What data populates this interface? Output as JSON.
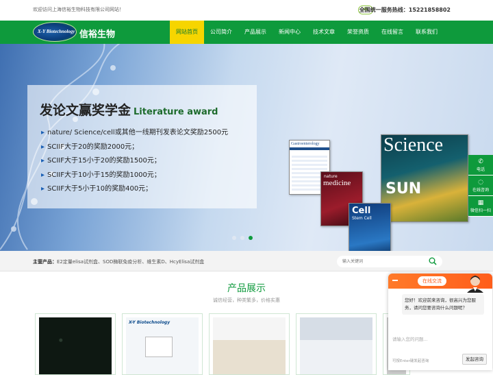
{
  "topbar": {
    "welcome": "欢迎访问上海信裕生物科技有限公司网站！",
    "hotline_label": "全国统一服务热线：",
    "hotline_number": "15221858802"
  },
  "logo": {
    "mark_text": "X-Y Biotechnology",
    "name": "信裕生物"
  },
  "nav": {
    "items": [
      "网站首页",
      "公司简介",
      "产品展示",
      "新闻中心",
      "技术文章",
      "荣誉资质",
      "在线留言",
      "联系我们"
    ],
    "active_index": 0
  },
  "banner": {
    "title": "发论文赢奖学金",
    "title_en": "Literature award",
    "list": [
      "nature/ Science/cell或其他一线期刊发表论文奖励2500元",
      "SCIIF大于20的奖励2000元；",
      "SCIIF大于15小于20的奖励1500元；",
      "SCIIF大于10小于15的奖励1000元；",
      "SCIIF大于5小于10的奖励400元；"
    ],
    "journals": {
      "gastro": "Gastroenterology",
      "medicine_top": "nature",
      "medicine": "medicine",
      "cell": "Cell",
      "cell_sub": "Stem Cell",
      "science": "Science",
      "science_cover": "SUN"
    },
    "slide_count": 3,
    "active_slide": 2
  },
  "sidebar": {
    "items": [
      {
        "label": "电话",
        "icon": "phone-icon"
      },
      {
        "label": "在线咨询",
        "icon": "chat-icon"
      },
      {
        "label": "微信扫一扫",
        "icon": "qr-code-icon"
      }
    ]
  },
  "keywords": {
    "label": "主营产品：",
    "text": "E2定量elisa试剂盒、SOD酶联免疫分析、维生素D、HcyElisa试剂盒"
  },
  "search": {
    "placeholder": "输入关键词"
  },
  "products": {
    "title": "产品展示",
    "subtitle": "诚信经营，种类繁多，价格实惠"
  },
  "chat": {
    "status": "在线交流",
    "greeting": "您好！欢迎前来咨询，很高兴为您服务，请问您要咨询什么问题呢？",
    "input_placeholder": "请输入您的问题...",
    "hint": "可按Enter键发起咨询",
    "send_label": "发起咨询"
  },
  "colors": {
    "brand_green": "#0e9a3c",
    "nav_active": "#f6d500",
    "chat_orange": "#ff5d1a"
  }
}
